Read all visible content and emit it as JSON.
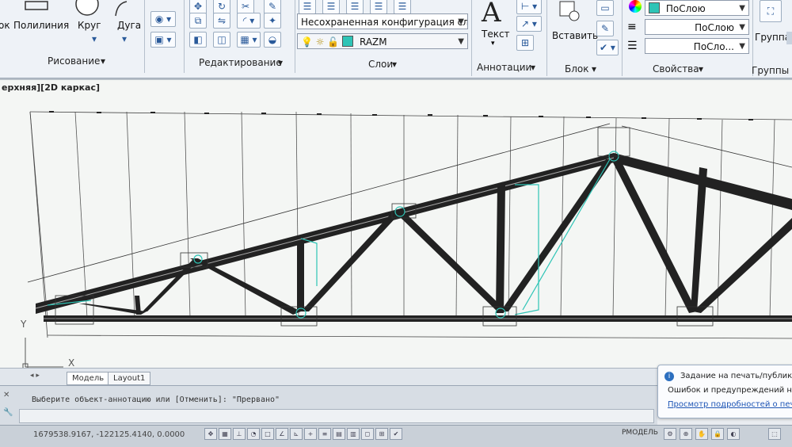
{
  "ribbon": {
    "draw": {
      "panel_title": "Рисование",
      "tools": {
        "polyline": "Полилиния",
        "circle": "Круг",
        "arc": "Дуга",
        "first_cut": "ок"
      }
    },
    "modify": {
      "panel_title": "Редактирование"
    },
    "layers": {
      "panel_title": "Слои",
      "layer_state_value": "Несохраненная конфигурация сло",
      "current_layer": "RAZM"
    },
    "annotation": {
      "panel_title": "Аннотации",
      "text_tool": "Текст",
      "text_glyph": "A"
    },
    "block": {
      "panel_title": "Блок",
      "insert_tool": "Вставить"
    },
    "properties": {
      "panel_title": "Свойства",
      "color_value": "ПоСлою",
      "linetype_value": "ПоСлою",
      "lineweight_value": "ПоСло..."
    },
    "groups": {
      "panel_title": "Группы",
      "group_tool": "Группа"
    }
  },
  "viewport": {
    "title": "ерхняя][2D каркас]",
    "ucs_y": "Y",
    "ucs_x": "X"
  },
  "tabs": {
    "model": "Модель",
    "layout1": "Layout1"
  },
  "command_line": {
    "history": "Выберите объект-аннотацию или [Отменить]: \"Прервано\""
  },
  "status_bar": {
    "coordinates": "1679538.9167, -122125.4140, 0.0000",
    "mode": "РМОДЕЛЬ"
  },
  "notification": {
    "title": "Задание на печать/публикаци",
    "message": "Ошибок и предупреждений не бы",
    "link": "Просмотр подробностей о печати"
  },
  "colors": {
    "accent_layer": "#2ec4b6",
    "ribbon_bg": "#eef2f7",
    "drawing_bg": "#f4f6f4"
  }
}
